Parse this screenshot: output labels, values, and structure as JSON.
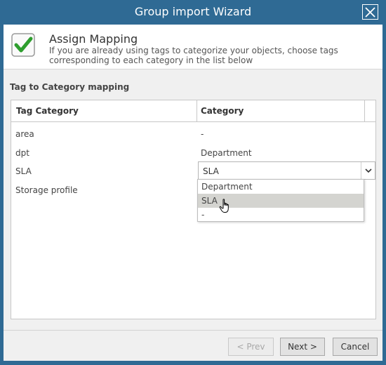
{
  "window": {
    "title": "Group import Wizard",
    "close_icon": "close-icon"
  },
  "header": {
    "icon": "checkbox-checked-icon",
    "title": "Assign Mapping",
    "description": "If you are already using tags to categorize your objects, choose tags corresponding to each category in the list below"
  },
  "section": {
    "label": "Tag to Category mapping"
  },
  "grid": {
    "columns": [
      "Tag Category",
      "Category"
    ],
    "rows": [
      {
        "tag": "area",
        "category": "-"
      },
      {
        "tag": "dpt",
        "category": "Department"
      },
      {
        "tag": "SLA",
        "category": "SLA"
      },
      {
        "tag": "Storage profile",
        "category": ""
      }
    ]
  },
  "dropdown": {
    "options": [
      "Department",
      "SLA",
      "-"
    ],
    "selected": "SLA"
  },
  "footer": {
    "prev_label": "< Prev",
    "next_label": "Next >",
    "cancel_label": "Cancel"
  },
  "colors": {
    "title_bar": "#2f6a94",
    "check_green": "#2e9e2e",
    "selected_option": "#d4d4d0"
  }
}
